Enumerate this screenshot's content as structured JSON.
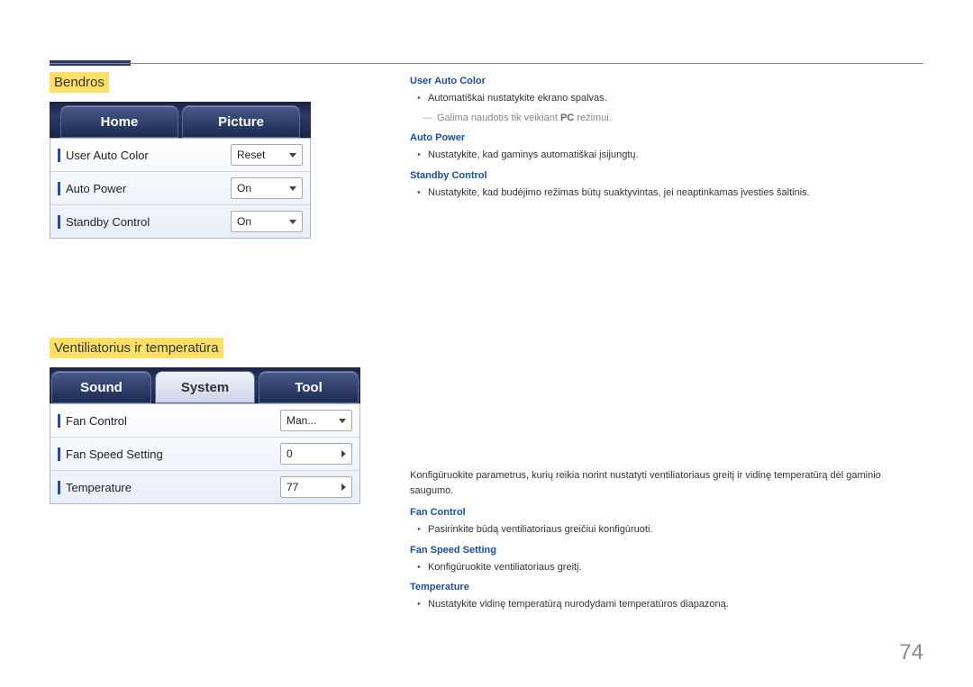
{
  "page_number": "74",
  "section1": {
    "title": "Bendros",
    "tabs": [
      "Home",
      "Picture"
    ],
    "rows": [
      {
        "label": "User Auto Color",
        "value": "Reset"
      },
      {
        "label": "Auto Power",
        "value": "On"
      },
      {
        "label": "Standby Control",
        "value": "On"
      }
    ],
    "desc": {
      "user_auto_color": {
        "title": "User Auto Color",
        "bullet": "Automatiškai nustatykite ekrano spalvas.",
        "note_pre": "Galima naudotis tik veikiant ",
        "note_bold": "PC",
        "note_post": " režimui."
      },
      "auto_power": {
        "title": "Auto Power",
        "bullet": "Nustatykite, kad gaminys automatiškai įsijungtų."
      },
      "standby_control": {
        "title": "Standby Control",
        "bullet": "Nustatykite, kad budėjimo režimas būtų suaktyvintas, jei neaptinkamas įvesties šaltinis."
      }
    }
  },
  "section2": {
    "title": "Ventiliatorius ir temperatūra",
    "tabs": [
      "Sound",
      "System",
      "Tool"
    ],
    "rows": [
      {
        "label": "Fan Control",
        "value": "Man...",
        "type": "dropdown"
      },
      {
        "label": "Fan Speed Setting",
        "value": "0",
        "type": "spinner"
      },
      {
        "label": "Temperature",
        "value": "77",
        "type": "spinner"
      }
    ],
    "intro": "Konfigūruokite parametrus, kurių reikia norint nustatyti ventiliatoriaus greitį ir vidinę temperatūrą dėl gaminio saugumo.",
    "desc": {
      "fan_control": {
        "title": "Fan Control",
        "bullet": "Pasirinkite būdą ventiliatoriaus greičiui konfigūruoti."
      },
      "fan_speed": {
        "title": "Fan Speed Setting",
        "bullet": "Konfigūruokite ventiliatoriaus greitį."
      },
      "temperature": {
        "title": "Temperature",
        "bullet": "Nustatykite vidinę temperatūrą nurodydami temperatūros diapazoną."
      }
    }
  }
}
